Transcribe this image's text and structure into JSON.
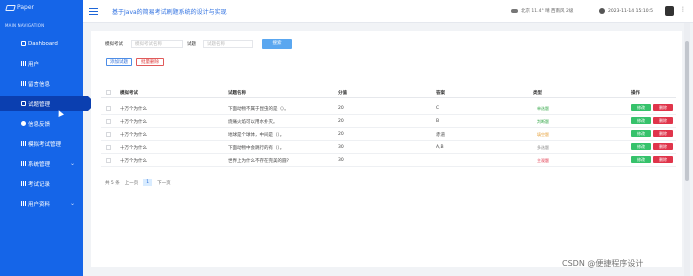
{
  "app": {
    "logo": "Paper",
    "title": "基于Java的简易考试刷题系统的设计与实现"
  },
  "sidebar": {
    "section_title": "MAIN NAVIGATION",
    "items": [
      {
        "label": "Dashboard",
        "icon": "home-icon"
      },
      {
        "label": "用户",
        "icon": "grid-icon"
      },
      {
        "label": "留言信息",
        "icon": "grid-icon"
      },
      {
        "label": "试题管理",
        "icon": "file-icon",
        "active": true
      },
      {
        "label": "信息反馈",
        "icon": "gear-icon"
      },
      {
        "label": "模拟考试管理",
        "icon": "grid-icon"
      },
      {
        "label": "系统管理",
        "icon": "grid-icon",
        "expandable": true
      },
      {
        "label": "考试记录",
        "icon": "grid-icon"
      },
      {
        "label": "用户资料",
        "icon": "grid-icon",
        "expandable": true
      }
    ]
  },
  "topbar": {
    "weather": "北京  11.4°  晴  西南风  2级",
    "datetime": "2023-11-14  15:10:5",
    "more": "⋮"
  },
  "filters": {
    "exam_label": "模拟考试",
    "exam_placeholder": "模拟考试名称",
    "question_label": "试题",
    "question_placeholder": "试题名称",
    "search_button": "搜索",
    "add_button": "添加试题",
    "batch_delete_button": "批量删除"
  },
  "table": {
    "headers": [
      "模拟考试",
      "试题名称",
      "分值",
      "答案",
      "类型",
      "操作"
    ],
    "rows": [
      {
        "exam": "十万个为什么",
        "question": "下面动物不属于昆虫的是（）。",
        "score": "20",
        "answer": "C",
        "type": "单选题",
        "type_color": "#36a84a"
      },
      {
        "exam": "十万个为什么",
        "question": "烧痛火焰可以用水扑灭。",
        "score": "20",
        "answer": "B",
        "type": "判断题",
        "type_color": "#36a84a"
      },
      {
        "exam": "十万个为什么",
        "question": "地球是个球体，中间是（）。",
        "score": "20",
        "answer": "赤道",
        "type": "填空题",
        "type_color": "#e6a23c"
      },
      {
        "exam": "十万个为什么",
        "question": "下面动物中会跳行的有（）。",
        "score": "30",
        "answer": "A,B",
        "type": "多选题",
        "type_color": "#888888"
      },
      {
        "exam": "十万个为什么",
        "question": "世界上为什么不存在完美的圆?",
        "score": "30",
        "answer": "",
        "type": "主观题",
        "type_color": "#e0354b"
      }
    ],
    "edit_label": "修改",
    "delete_label": "删除"
  },
  "pager": {
    "total": "共 5 条",
    "prev": "上一页",
    "page": "1",
    "next": "下一页"
  },
  "watermark": "CSDN @便捷程序设计",
  "colors": {
    "sidebar": "#1565e8",
    "active": "#0b3fb0",
    "edit": "#36c26b",
    "delete": "#e0354b"
  }
}
